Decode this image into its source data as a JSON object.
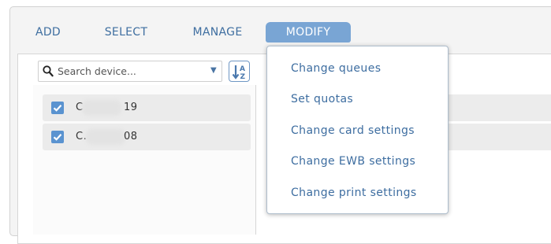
{
  "menu": {
    "tabs": [
      {
        "label": "ADD"
      },
      {
        "label": "SELECT"
      },
      {
        "label": "MANAGE"
      },
      {
        "label": "MODIFY",
        "active": true
      }
    ]
  },
  "search": {
    "placeholder": "Search device..."
  },
  "devices": [
    {
      "prefix": "C",
      "suffix": "19",
      "checked": true
    },
    {
      "prefix": "C.",
      "suffix": "08",
      "checked": true
    }
  ],
  "modify_menu": {
    "items": [
      {
        "label": "Change queues"
      },
      {
        "label": "Set quotas"
      },
      {
        "label": "Change card settings"
      },
      {
        "label": "Change EWB settings"
      },
      {
        "label": "Change print settings"
      }
    ]
  },
  "icons": {
    "search": "search-icon",
    "dropdown": "chevron-down-icon",
    "sort": "sort-az-icon",
    "checkbox": "checkbox-checked-icon"
  },
  "colors": {
    "accent": "#79a5d4",
    "link": "#3e6ea0",
    "checkbox": "#5a93d0"
  }
}
